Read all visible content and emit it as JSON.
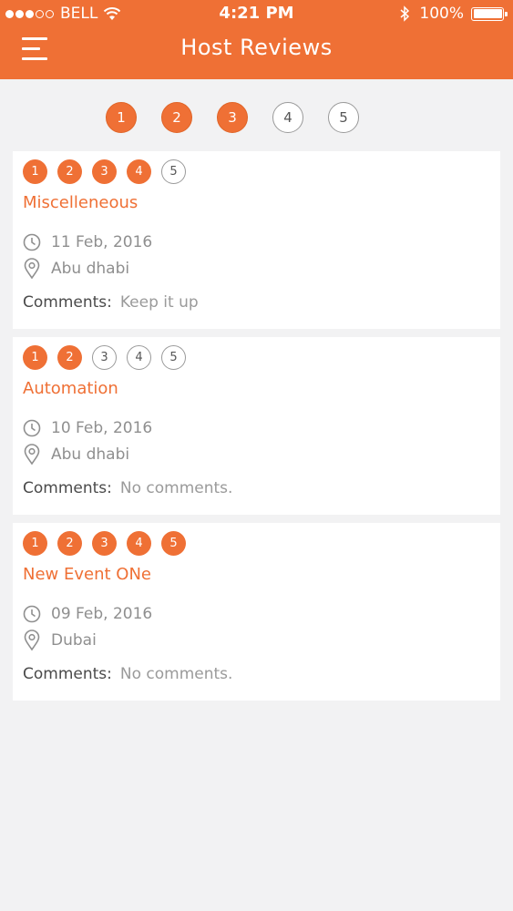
{
  "status_bar": {
    "carrier": "BELL",
    "time": "4:21 PM",
    "battery": "100%",
    "signal_bars": 3
  },
  "header": {
    "title": "Host Reviews",
    "menu_icon": "hamburger-menu-icon"
  },
  "rating_filter": {
    "options": [
      "1",
      "2",
      "3",
      "4",
      "5"
    ],
    "selected_up_to": 3
  },
  "reviews": [
    {
      "rating": 4,
      "rating_labels": [
        "1",
        "2",
        "3",
        "4",
        "5"
      ],
      "title": "Miscelleneous",
      "date": "11 Feb, 2016",
      "location": "Abu dhabi",
      "comments_label": "Comments:",
      "comments": "Keep it up"
    },
    {
      "rating": 2,
      "rating_labels": [
        "1",
        "2",
        "3",
        "4",
        "5"
      ],
      "title": "Automation",
      "date": "10 Feb, 2016",
      "location": "Abu dhabi",
      "comments_label": "Comments:",
      "comments": "No comments."
    },
    {
      "rating": 5,
      "rating_labels": [
        "1",
        "2",
        "3",
        "4",
        "5"
      ],
      "title": "New Event ONe",
      "date": "09 Feb, 2016",
      "location": "Dubai",
      "comments_label": "Comments:",
      "comments": "No comments."
    }
  ],
  "colors": {
    "accent": "#ef7035",
    "background": "#f2f2f3"
  }
}
